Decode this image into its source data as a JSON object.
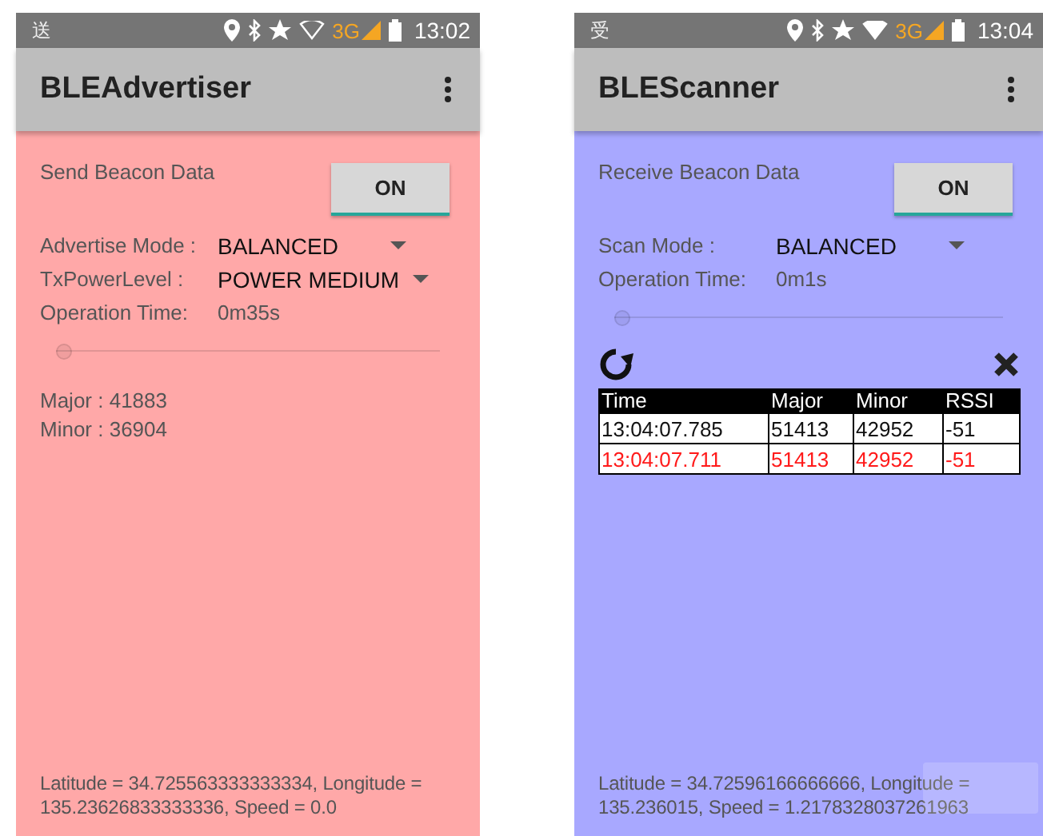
{
  "screens": [
    {
      "color": "#ffa8a8",
      "notification": "送",
      "wifi_connected": false,
      "network": "3G",
      "time": "13:02",
      "title": "BLEAdvertiser",
      "section_label": "Send Beacon Data",
      "toggle": "ON",
      "settings": [
        {
          "kind": "dropdown",
          "label": "Advertise Mode :",
          "value": "BALANCED"
        },
        {
          "kind": "dropdown",
          "label": "TxPowerLevel :",
          "value": "POWER MEDIUM"
        },
        {
          "kind": "text",
          "label": "Operation Time:",
          "value": "0m35s"
        }
      ],
      "slider": {
        "level": 0
      },
      "info_lines": [
        "Major : 41883",
        "Minor : 36904"
      ],
      "location": "Latitude = 34.725563333333334, Longitude = 135.23626833333336, Speed = 0.0"
    },
    {
      "color": "#a8a8ff",
      "notification": "受",
      "wifi_connected": true,
      "network": "3G",
      "time": "13:04",
      "title": "BLEScanner",
      "section_label": "Receive Beacon Data",
      "toggle": "ON",
      "settings": [
        {
          "kind": "dropdown",
          "label": "Scan Mode :",
          "value": "BALANCED"
        },
        {
          "kind": "text",
          "label": "Operation Time:",
          "value": "0m1s"
        }
      ],
      "slider": {
        "level": 0
      },
      "table": {
        "columns": [
          "Time",
          "Major",
          "Minor",
          "RSSI"
        ],
        "rows": [
          {
            "highlighted": false,
            "cells": [
              "13:04:07.785",
              "51413",
              "42952",
              "-51"
            ]
          },
          {
            "highlighted": true,
            "cells": [
              "13:04:07.711",
              "51413",
              "42952",
              "-51"
            ]
          }
        ]
      },
      "location": "Latitude = 34.72596166666666, Longitude = 135.236015, Speed = 1.2178328037261963",
      "faded_button": true
    }
  ]
}
